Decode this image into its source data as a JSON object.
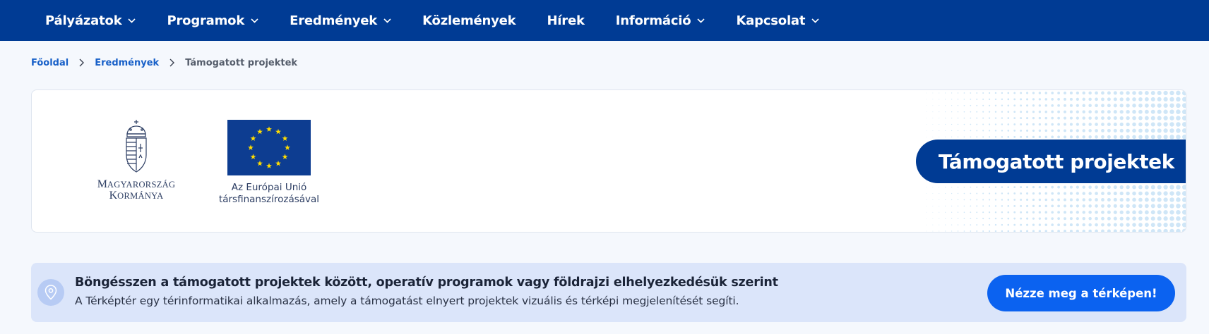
{
  "nav": {
    "items": [
      {
        "label": "Pályázatok",
        "dropdown": true
      },
      {
        "label": "Programok",
        "dropdown": true
      },
      {
        "label": "Eredmények",
        "dropdown": true
      },
      {
        "label": "Közlemények",
        "dropdown": false
      },
      {
        "label": "Hírek",
        "dropdown": false
      },
      {
        "label": "Információ",
        "dropdown": true
      },
      {
        "label": "Kapcsolat",
        "dropdown": true
      }
    ]
  },
  "breadcrumb": {
    "home": "Főoldal",
    "parent": "Eredmények",
    "current": "Támogatott projektek"
  },
  "hero": {
    "gov_logo_line1": "Magyarország",
    "gov_logo_line2": "Kormánya",
    "eu_logo_line1": "Az Európai Unió",
    "eu_logo_line2": "társfinanszírozásával",
    "title": "Támogatott projektek"
  },
  "map_banner": {
    "title": "Böngésszen a támogatott projektek között, operatív programok vagy földrajzi elhelyezkedésük szerint",
    "subtitle": "A Térképtér egy térinformatikai alkalmazás, amely a támogatást elnyert projektek vizuális és térképi megjelenítését segíti.",
    "button_label": "Nézze meg a térképen!"
  },
  "colors": {
    "nav_bg": "#003b94",
    "accent": "#0b62f0",
    "link": "#1860c8",
    "banner_bg": "#dbe5fa",
    "eu_flag": "#0d3d91",
    "eu_star": "#ffdd00"
  },
  "icons": {
    "dropdown": "chevron-down-icon",
    "breadcrumb_separator": "chevron-right-icon",
    "map": "map-pin-icon"
  }
}
